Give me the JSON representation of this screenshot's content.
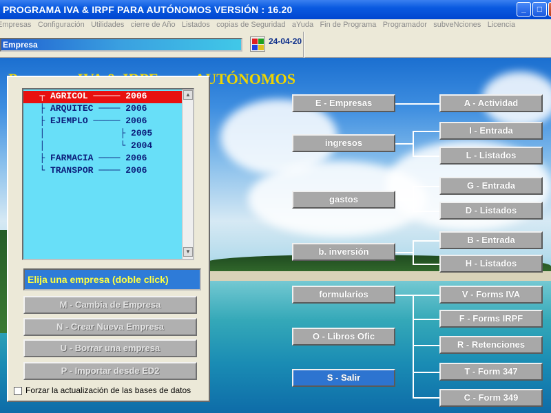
{
  "window": {
    "title": "PROGRAMA IVA & IRPF PARA AUTÓNOMOS  VERSIÓN : 16.20",
    "buttons": {
      "minimize": "_",
      "maximize": "□",
      "close": "X"
    }
  },
  "menu": [
    "Empresas",
    "Configuración",
    "Utilidades",
    "cierre de Año",
    "Listados",
    "copias de Seguridad",
    "aYuda",
    "Fin de Programa",
    "Programador",
    "subveNciones",
    "Licencia"
  ],
  "toolbar": {
    "company_label": "Empresa",
    "date": "24-04-20"
  },
  "headline": "Programa IVA & IRPF para AUTÓNOMOS",
  "company_tree": [
    {
      "name": "AGRICOL",
      "connector": "┬ ",
      "year": "2006",
      "selected": true
    },
    {
      "name": "ARQUITEC",
      "connector": "├ ",
      "year": "2006",
      "selected": false
    },
    {
      "name": "EJEMPLO",
      "connector": "├ ",
      "year": "2006",
      "selected": false
    },
    {
      "name": "",
      "connector": "│ ",
      "year": "2005",
      "selected": false
    },
    {
      "name": "",
      "connector": "│ ",
      "year": "2004",
      "selected": false
    },
    {
      "name": "FARMACIA",
      "connector": "├ ",
      "year": "2006",
      "selected": false
    },
    {
      "name": "TRANSPOR",
      "connector": "└ ",
      "year": "2006",
      "selected": false
    }
  ],
  "panel": {
    "prompt": "Elija una empresa (doble click)",
    "buttons": [
      "M - Cambia de Empresa",
      "N - Crear Nueva Empresa",
      "U - Borrar una empresa",
      "P - Importar desde ED2"
    ],
    "checkbox_label": "Forzar la actualización de las bases de datos"
  },
  "main_buttons": {
    "empresas": "E - Empresas",
    "actividad": "A - Actividad",
    "ingresos": "ingresos",
    "ingresos_entrada": "I - Entrada",
    "ingresos_listados": "L - Listados",
    "gastos": "gastos",
    "gastos_entrada": "G - Entrada",
    "gastos_listados": "D - Listados",
    "inversion": "b. inversión",
    "inversion_entrada": "B - Entrada",
    "inversion_listados": "H - Listados",
    "formularios": "formularios",
    "forms_iva": "V - Forms  IVA",
    "forms_irpf": "F - Forms IRPF",
    "retenciones": "R - Retenciones",
    "form_347": "T - Form  347",
    "form_349": "C - Form  349",
    "libros": "O - Libros Ofic",
    "salir": "S - Salir"
  }
}
